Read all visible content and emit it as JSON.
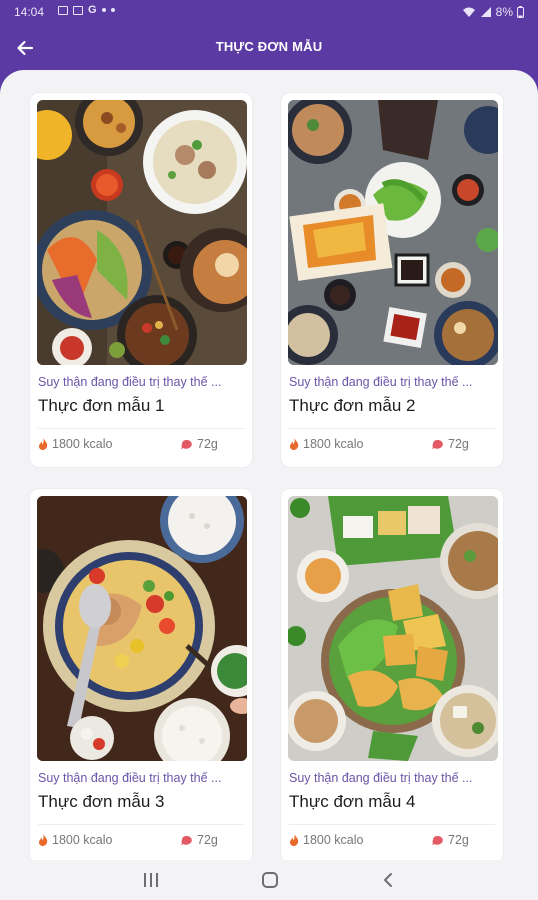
{
  "status_bar": {
    "time": "14:04",
    "battery": "8%"
  },
  "app_bar": {
    "title": "THỰC ĐƠN MẪU"
  },
  "cards": [
    {
      "subtitle": "Suy thận đang điều trị thay thế ...",
      "title": "Thực đơn mẫu 1",
      "calories": "1800 kcalo",
      "protein": "72g"
    },
    {
      "subtitle": "Suy thận đang điều trị thay thế ...",
      "title": "Thực đơn mẫu 2",
      "calories": "1800 kcalo",
      "protein": "72g"
    },
    {
      "subtitle": "Suy thận đang điều trị thay thế ...",
      "title": "Thực đơn mẫu 3",
      "calories": "1800 kcalo",
      "protein": "72g"
    },
    {
      "subtitle": "Suy thận đang điều trị thay thế ...",
      "title": "Thực đơn mẫu 4",
      "calories": "1800 kcalo",
      "protein": "72g"
    }
  ],
  "icons": {
    "back": "arrow-left-icon",
    "calories": "flame-icon",
    "protein": "meat-icon"
  },
  "colors": {
    "primary": "#5b3aa3",
    "subtitle": "#6a55a8",
    "flame": "#e8692a",
    "meat": "#e35a64"
  }
}
